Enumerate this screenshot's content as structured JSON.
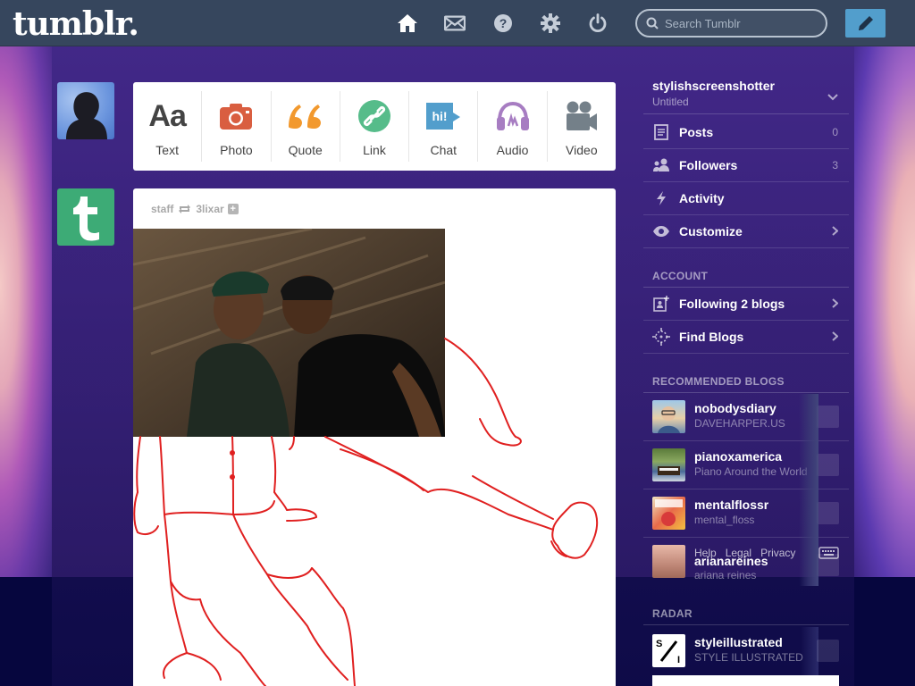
{
  "header": {
    "logo": "tumblr.",
    "search_placeholder": "Search Tumblr",
    "nav": [
      "home-icon",
      "mail-icon",
      "help-icon",
      "gear-icon",
      "power-icon"
    ],
    "compose_icon": "pencil-icon",
    "bg_color": "#36465d",
    "compose_color": "#529ecc"
  },
  "post_types": [
    {
      "label": "Text",
      "icon": "text-icon",
      "color": "#444444"
    },
    {
      "label": "Photo",
      "icon": "camera-icon",
      "color": "#d95e40"
    },
    {
      "label": "Quote",
      "icon": "quote-icon",
      "color": "#f2992e"
    },
    {
      "label": "Link",
      "icon": "link-icon",
      "color": "#56bc8a"
    },
    {
      "label": "Chat",
      "icon": "chat-icon",
      "color": "#529ecc"
    },
    {
      "label": "Audio",
      "icon": "headphones-icon",
      "color": "#a77dc2"
    },
    {
      "label": "Video",
      "icon": "video-camera-icon",
      "color": "#748089"
    }
  ],
  "post": {
    "author": "staff",
    "reblogged_from": "3lixar"
  },
  "sidebar": {
    "blog_name": "stylishscreenshotter",
    "blog_title": "Untitled",
    "items": [
      {
        "label": "Posts",
        "count": "0",
        "icon": "posts-icon"
      },
      {
        "label": "Followers",
        "count": "3",
        "icon": "followers-icon"
      },
      {
        "label": "Activity",
        "icon": "activity-icon"
      },
      {
        "label": "Customize",
        "icon": "eye-icon"
      }
    ],
    "account_title": "ACCOUNT",
    "account_items": [
      {
        "label": "Following 2 blogs",
        "icon": "following-icon"
      },
      {
        "label": "Find Blogs",
        "icon": "find-blogs-icon"
      }
    ],
    "recommended_title": "RECOMMENDED BLOGS",
    "recommended": [
      {
        "name": "nobodysdiary",
        "sub": "DAVEHARPER.US"
      },
      {
        "name": "pianoxamerica",
        "sub": "Piano Around the World"
      },
      {
        "name": "mentalflossr",
        "sub": "mental_floss"
      },
      {
        "name": "arianareines",
        "sub": "ariana reines"
      }
    ],
    "footer_links": [
      "Help",
      "Legal",
      "Privacy"
    ],
    "radar_title": "RADAR",
    "radar": {
      "name": "styleillustrated",
      "sub": "STYLE ILLUSTRATED"
    }
  }
}
